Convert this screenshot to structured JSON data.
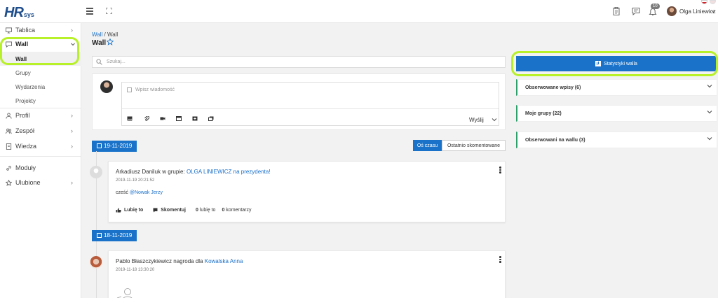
{
  "brand": {
    "logo_main": "HR",
    "logo_sub": "sys"
  },
  "header": {
    "notification_count": "10",
    "user_name": "Olga Liniewicz"
  },
  "sidebar": {
    "items": [
      {
        "label": "Tablica",
        "icon": "monitor-icon"
      },
      {
        "label": "Wall",
        "icon": "chat-icon"
      },
      {
        "label": "Profil",
        "icon": "user-icon"
      },
      {
        "label": "Zespół",
        "icon": "team-icon"
      },
      {
        "label": "Wiedza",
        "icon": "book-icon"
      },
      {
        "label": "Moduły",
        "icon": "link-icon"
      },
      {
        "label": "Ulubione",
        "icon": "star-icon"
      }
    ],
    "wall_sub": [
      "Wall",
      "Grupy",
      "Wydarzenia",
      "Projekty"
    ]
  },
  "main": {
    "breadcrumb": {
      "root": "Wall",
      "sep": " / ",
      "current": "Wall"
    },
    "title": "Wall",
    "search_placeholder": "Szukaj...",
    "composer": {
      "placeholder": "Wpisz wiadomość",
      "send_label": "Wyślij"
    },
    "sort": {
      "timeline": "Oś czasu",
      "recent": "Ostatnio skomentowane"
    },
    "dates": [
      "19-11-2019",
      "18-11-2019"
    ],
    "posts": [
      {
        "author": "Arkadiusz Daniluk",
        "action": " w grupie: ",
        "target": "OLGA LINIEWICZ na prezydenta!",
        "time": "2019-11-19 20:21:52",
        "body": "cześć ",
        "mention": "@Nowak Jerzy",
        "like_label": "Lubię to",
        "comment_label": "Skomentuj",
        "likes_count": "0",
        "likes_text": " lubię to",
        "comments_count": "0",
        "comments_text": " komentarzy"
      },
      {
        "author": "Pablo Błaszczykiewicz",
        "action": " nagroda dla ",
        "target": "Kowalska Anna",
        "time": "2019-11-18 13:30:20"
      }
    ]
  },
  "right_panel": {
    "stats_button": "Statystyki walla",
    "sections": [
      "Obserwowane wpisy (6)",
      "Moje grupy (22)",
      "Obserwowani na wallu (3)"
    ]
  },
  "colors": {
    "accent": "#1a73c9",
    "highlight": "#b8f02a",
    "panel_border": "#2e9e6a"
  }
}
